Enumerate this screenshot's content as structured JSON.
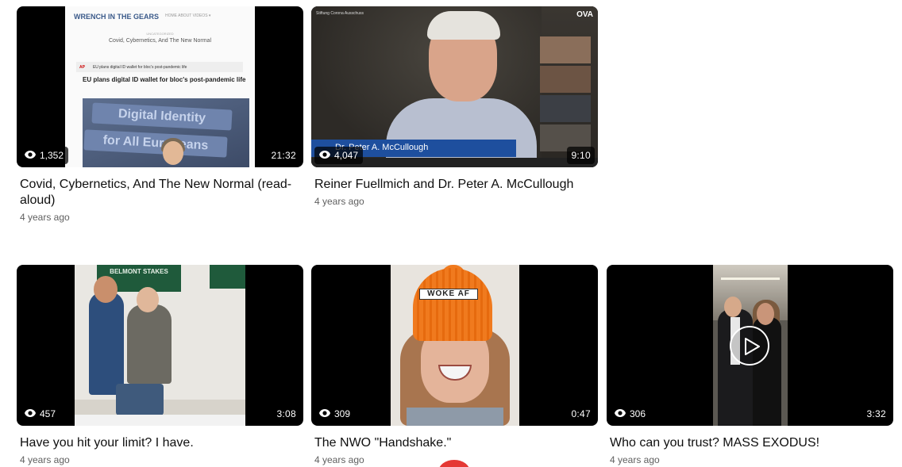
{
  "videos": [
    {
      "views": "1,352",
      "duration": "21:32",
      "title": "Covid, Cybernetics, And The New Normal (read-aloud)",
      "date": "4 years ago",
      "thumb": {
        "site": "WRENCH IN THE GEARS",
        "nav": "HOME  ABOUT  VIDEOS ▾",
        "category": "UNCATEGORIZED",
        "article_title": "Covid, Cybernetics, And The New Normal",
        "ap_label": "AP",
        "ap_text": "EU plans digital ID wallet for bloc's post-pandemic life",
        "headline": "EU plans digital ID wallet for bloc's post-pandemic life",
        "sign1": "Digital Identity",
        "sign2": "for All Europeans"
      }
    },
    {
      "views": "4,047",
      "duration": "9:10",
      "title": "Reiner Fuellmich and Dr. Peter A. McCullough",
      "date": "4 years ago",
      "thumb": {
        "logo_left": "Stiftung Corona Ausschuss",
        "logo_right": "OVA",
        "lower_third": "Dr. Peter A. McCullough"
      }
    },
    {
      "views": "457",
      "duration": "3:08",
      "title": "Have you hit your limit? I have.",
      "date": "4 years ago",
      "thumb": {
        "banner": "BELMONT STAKES"
      }
    },
    {
      "views": "309",
      "duration": "0:47",
      "title": "The NWO \"Handshake.\"",
      "date": "4 years ago",
      "thumb": {
        "hat_label": "WOKE AF"
      }
    },
    {
      "views": "306",
      "duration": "3:32",
      "title": "Who can you trust? MASS EXODUS!",
      "date": "4 years ago"
    }
  ],
  "colors": {
    "overlay": "#000000b8",
    "date": "#606060",
    "accent": "#e53935"
  }
}
